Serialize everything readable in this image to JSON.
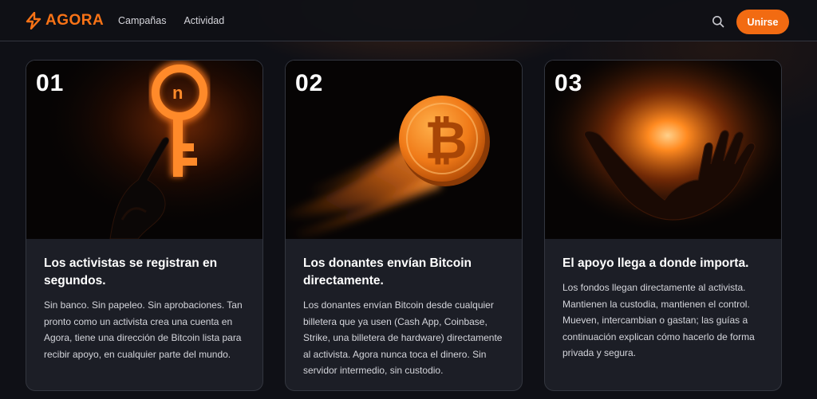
{
  "header": {
    "logo_text": "AGORA",
    "nav": [
      "Campañas",
      "Actividad"
    ],
    "join_label": "Unirse"
  },
  "colors": {
    "accent": "#f26b12",
    "background": "#0f1016",
    "card": "#1c1e26"
  },
  "cards": [
    {
      "number": "01",
      "image_icon": "glowing-key-hand-icon",
      "title": "Los activistas se registran en segundos.",
      "description": "Sin banco. Sin papeleo. Sin aprobaciones. Tan pronto como un activista crea una cuenta en Agora, tiene una dirección de Bitcoin lista para recibir apoyo, en cualquier parte del mundo."
    },
    {
      "number": "02",
      "image_icon": "flying-bitcoin-coin-icon",
      "title": "Los donantes envían Bitcoin directamente.",
      "description": "Los donantes envían Bitcoin desde cualquier billetera que ya usen (Cash App, Coinbase, Strike, una billetera de hardware) directamente al activista. Agora nunca toca el dinero. Sin servidor intermedio, sin custodio."
    },
    {
      "number": "03",
      "image_icon": "open-hand-glow-icon",
      "title": "El apoyo llega a donde importa.",
      "description": "Los fondos llegan directamente al activista. Mantienen la custodia, mantienen el control. Mueven, intercambian o gastan; las guías a continuación explican cómo hacerlo de forma privada y segura."
    }
  ]
}
